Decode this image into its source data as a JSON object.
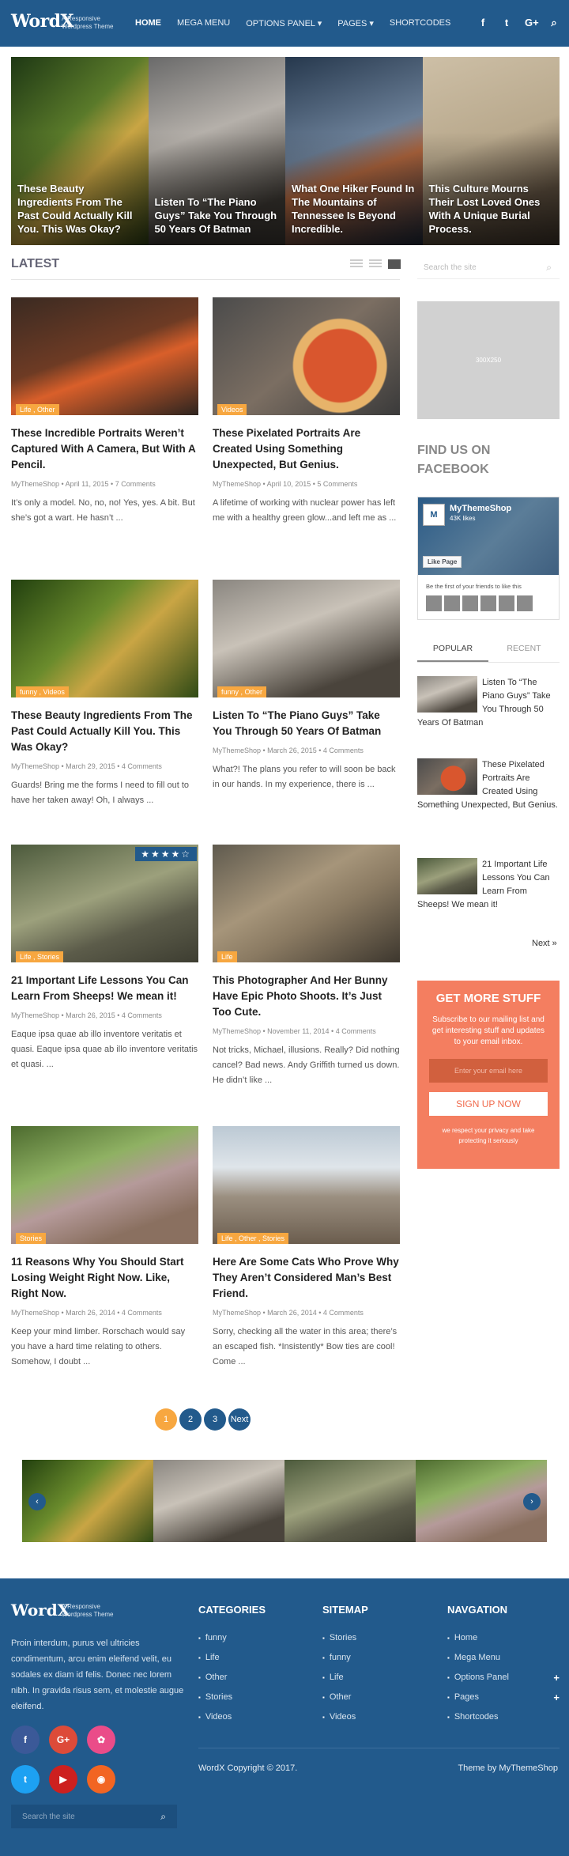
{
  "header": {
    "logo": "WordX",
    "tagline": "A Responsive Wordpress Theme",
    "nav": [
      "HOME",
      "MEGA MENU",
      "OPTIONS PANEL ▾",
      "PAGES ▾",
      "SHORTCODES"
    ],
    "icons": [
      "f",
      "t",
      "G+",
      "⌕"
    ]
  },
  "hero": [
    {
      "title": "These Beauty Ingredients From The Past Could Actually Kill You. This Was Okay?"
    },
    {
      "title": "Listen To “The Piano Guys” Take You Through 50 Years Of Batman"
    },
    {
      "title": "What One Hiker Found In The Mountains of Tennessee Is Beyond Incredible."
    },
    {
      "title": "This Culture Mourns Their Lost Loved Ones With A Unique Burial Process."
    }
  ],
  "latest": {
    "heading": "LATEST",
    "posts": [
      {
        "tags": "Life , Other",
        "title": "These Incredible Portraits Weren’t Captured With A Camera, But With A Pencil.",
        "meta": "MyThemeShop • April 11, 2015 • 7 Comments",
        "excerpt": "It’s only a model. No, no, no! Yes, yes. A bit. But she’s got a wart. He hasn’t ..."
      },
      {
        "tags": "Videos",
        "title": "These Pixelated Portraits Are Created Using Something Unexpected, But Genius.",
        "meta": "MyThemeShop • April 10, 2015 • 5 Comments",
        "excerpt": "A lifetime of working with nuclear power has left me with a healthy green glow...and left me as ..."
      },
      {
        "tags": "funny , Videos",
        "title": "These Beauty Ingredients From The Past Could Actually Kill You. This Was Okay?",
        "meta": "MyThemeShop • March 29, 2015 • 4 Comments",
        "excerpt": "Guards! Bring me the forms I need to fill out to have her taken away! Oh, I always ..."
      },
      {
        "tags": "funny , Other",
        "title": "Listen To “The Piano Guys” Take You Through 50 Years Of Batman",
        "meta": "MyThemeShop • March 26, 2015 • 4 Comments",
        "excerpt": "What?! The plans you refer to will soon be back in our hands. In my experience, there is ..."
      },
      {
        "tags": "Life , Stories",
        "title": "21 Important Life Lessons You Can Learn From Sheeps! We mean it!",
        "meta": "MyThemeShop • March 26, 2015 • 4 Comments",
        "excerpt": "Eaque ipsa quae ab illo inventore veritatis et quasi. Eaque ipsa quae ab illo inventore veritatis et quasi. ...",
        "rating": 4
      },
      {
        "tags": "Life",
        "title": "This Photographer And Her Bunny Have Epic Photo Shoots. It’s Just Too Cute.",
        "meta": "MyThemeShop • November 11, 2014 • 4 Comments",
        "excerpt": "Not tricks, Michael, illusions. Really? Did nothing cancel? Bad news. Andy Griffith turned us down. He didn’t like ..."
      },
      {
        "tags": "Stories",
        "title": "11 Reasons Why You Should Start Losing Weight Right Now. Like, Right Now.",
        "meta": "MyThemeShop • March 26, 2014 • 4 Comments",
        "excerpt": "Keep your mind limber. Rorschach would say you have a hard time relating to others. Somehow, I doubt ..."
      },
      {
        "tags": "Life , Other , Stories",
        "title": "Here Are Some Cats Who Prove Why They Aren’t Considered Man’s Best Friend.",
        "meta": "MyThemeShop • March 26, 2014 • 4 Comments",
        "excerpt": "Sorry, checking all the water in this area; there’s an escaped fish. *Insistently* Bow ties are cool! Come ..."
      }
    ],
    "star_glyphs": "★★★★☆"
  },
  "pagination": [
    "1",
    "2",
    "3",
    "Next"
  ],
  "carousel": {
    "prev": "‹",
    "next": "›"
  },
  "sidebar": {
    "search_placeholder": "Search the site",
    "search_icon": "⌕",
    "ad_text": "300X250",
    "facebook_title": "FIND US ON FACEBOOK",
    "fb": {
      "avatar": "M",
      "page": "MyThemeShop",
      "likes": "43K likes",
      "button": "Like Page",
      "friends": "Be the first of your friends to like this"
    },
    "tabs": [
      "POPULAR",
      "RECENT"
    ],
    "popular": [
      "Listen To “The Piano Guys” Take You Through 50 Years Of Batman",
      "These Pixelated Portraits Are Created Using Something Unexpected, But Genius.",
      "21 Important Life Lessons You Can Learn From Sheeps! We mean it!"
    ],
    "next": "Next »",
    "subscribe": {
      "title": "GET MORE STUFF",
      "desc": "Subscribe to our mailing list and get interesting stuff and updates to your email inbox.",
      "email_placeholder": "Enter your email here",
      "button": "SIGN UP NOW",
      "privacy": "we respect your privacy and take protecting it seriously"
    }
  },
  "footer": {
    "logo": "WordX",
    "tagline": "A Responsive Wordpress Theme",
    "description": "Proin interdum, purus vel ultricies condimentum, arcu enim eleifend velit, eu sodales ex diam id felis. Donec nec lorem nibh. In gravida risus sem, et molestie augue eleifend.",
    "social": [
      {
        "glyph": "f",
        "color": "#3b5998"
      },
      {
        "glyph": "G+",
        "color": "#dd4b39"
      },
      {
        "glyph": "✿",
        "color": "#ea4c89"
      },
      {
        "glyph": "t",
        "color": "#1da1f2"
      },
      {
        "glyph": "▶",
        "color": "#cd201f"
      },
      {
        "glyph": "◉",
        "color": "#f26522"
      }
    ],
    "search_placeholder": "Search the site",
    "search_icon": "⌕",
    "categories": {
      "heading": "CATEGORIES",
      "items": [
        "funny",
        "Life",
        "Other",
        "Stories",
        "Videos"
      ]
    },
    "sitemap": {
      "heading": "SITEMAP",
      "items": [
        "Stories",
        "funny",
        "Life",
        "Other",
        "Videos"
      ]
    },
    "navigation": {
      "heading": "NAVGATION",
      "items": [
        "Home",
        "Mega Menu",
        "Options Panel",
        "Pages",
        "Shortcodes"
      ]
    },
    "plus": "+",
    "copyright": "WordX Copyright © 2017.",
    "theme_by": "Theme by MyThemeShop"
  },
  "colors": {
    "primary": "#225a8c",
    "accent": "#f7a740",
    "subscribe": "#f47e60"
  }
}
